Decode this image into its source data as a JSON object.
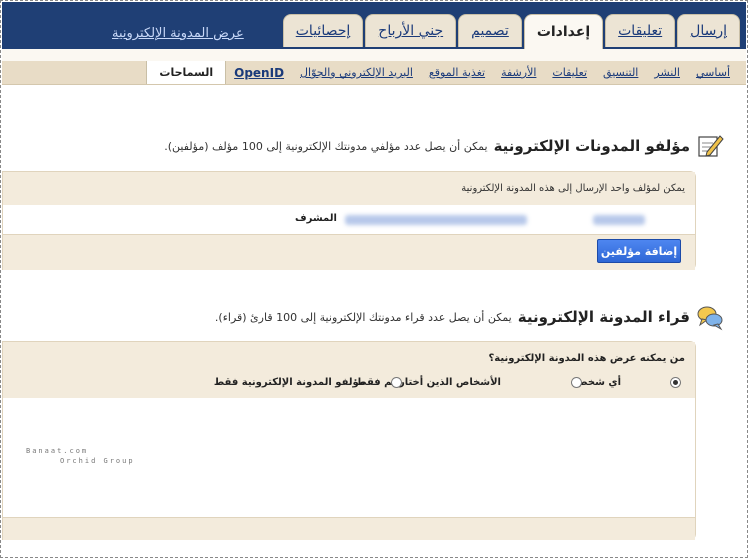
{
  "top_tabs": [
    {
      "label": "إرسال"
    },
    {
      "label": "تعليقات"
    },
    {
      "label": "إعدادات"
    },
    {
      "label": "تصميم"
    },
    {
      "label": "جني الأرباح"
    },
    {
      "label": "إحصائيات"
    }
  ],
  "view_blog_link": "عرض المدونة الإلكترونية",
  "sub_tabs": [
    {
      "label": "أساسي"
    },
    {
      "label": "النشر"
    },
    {
      "label": "التنسيق"
    },
    {
      "label": "تعليقات"
    },
    {
      "label": "الأرشفة"
    },
    {
      "label": "تغذية الموقع"
    },
    {
      "label": "البريد الإلكتروني والجوّال"
    },
    {
      "label": "OpenID"
    },
    {
      "label": "السماحات"
    }
  ],
  "authors": {
    "title": "مؤلفو المدونات الإلكترونية",
    "desc": "يمكن أن يصل عدد مؤلفي مدونتك الإلكترونية إلى 100 مؤلف (مؤلفين).",
    "only_one": "يمكن لمؤلف واحد الإرسال إلى هذه المدونة الإلكترونية",
    "role": "المشرف",
    "add_button": "إضافة مؤلفين"
  },
  "readers": {
    "title": "قراء المدونة الإلكترونية",
    "desc": "يمكن أن يصل عدد قراء مدونتك الإلكترونية إلى 100 قارئ (قراء).",
    "question": "من يمكنه عرض هذه المدونة الإلكترونية؟",
    "options": [
      {
        "label": "أي شخص",
        "selected": true
      },
      {
        "label": "الأشخاص الذين أختارهم فقط",
        "selected": false
      },
      {
        "label": "مؤلفو المدونة الإلكترونية فقط",
        "selected": false
      }
    ]
  },
  "watermark": {
    "line1": "Banaat.com",
    "line2": "Orchid Group"
  },
  "colors": {
    "topbar": "#1f3f75",
    "tab": "#ece4d4",
    "subtabs": "#e8dcc6",
    "button": "#3b74e0"
  }
}
